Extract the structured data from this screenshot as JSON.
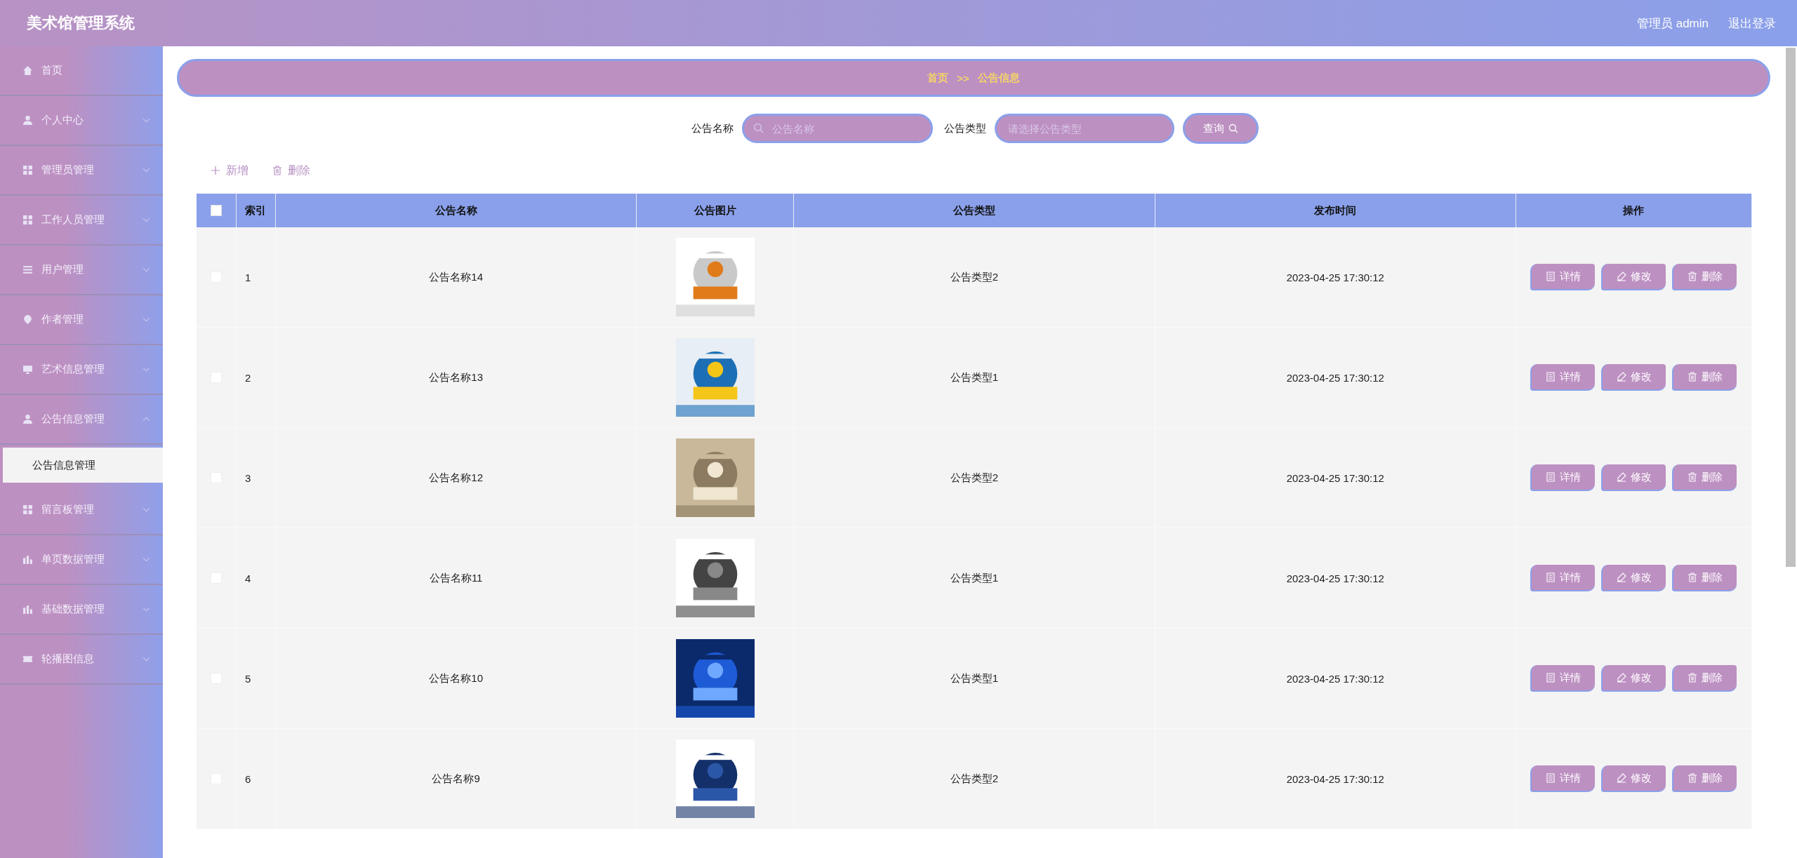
{
  "header": {
    "title": "美术馆管理系统",
    "user": "管理员 admin",
    "logout": "退出登录"
  },
  "sidebar": {
    "items": [
      {
        "label": "首页",
        "kind": "link"
      },
      {
        "label": "个人中心",
        "kind": "menu",
        "expanded": false
      },
      {
        "label": "管理员管理",
        "kind": "menu",
        "expanded": false
      },
      {
        "label": "工作人员管理",
        "kind": "menu",
        "expanded": false
      },
      {
        "label": "用户管理",
        "kind": "menu",
        "expanded": false
      },
      {
        "label": "作者管理",
        "kind": "menu",
        "expanded": false
      },
      {
        "label": "艺术信息管理",
        "kind": "menu",
        "expanded": false
      },
      {
        "label": "公告信息管理",
        "kind": "menu",
        "expanded": true,
        "children": [
          {
            "label": "公告信息管理",
            "selected": true
          }
        ]
      },
      {
        "label": "留言板管理",
        "kind": "menu",
        "expanded": false
      },
      {
        "label": "单页数据管理",
        "kind": "menu",
        "expanded": false
      },
      {
        "label": "基础数据管理",
        "kind": "menu",
        "expanded": false
      },
      {
        "label": "轮播图信息",
        "kind": "menu",
        "expanded": false
      }
    ]
  },
  "breadcrumb": [
    "首页",
    ">>",
    "公告信息"
  ],
  "search": {
    "fields": [
      {
        "label": "公告名称",
        "placeholder": "公告名称",
        "kind": "text"
      },
      {
        "label": "公告类型",
        "placeholder": "请选择公告类型",
        "kind": "select"
      }
    ],
    "button": "查询"
  },
  "actions": [
    {
      "label": "新增",
      "kind": "add"
    },
    {
      "label": "删除",
      "kind": "delete"
    }
  ],
  "table": {
    "select_all": {
      "checked": false
    },
    "columns": [
      "索引",
      "公告名称",
      "公告图片",
      "公告类型",
      "发布时间",
      "操作"
    ],
    "rows": [
      {
        "checked": false,
        "index": "1",
        "name": "公告名称14",
        "type": "公告类型2",
        "time": "2023-04-25 17:30:12",
        "actions": [
          {
            "label": "详情",
            "kind": "detail"
          },
          {
            "label": "修改",
            "kind": "edit"
          },
          {
            "label": "删除",
            "kind": "delete"
          }
        ]
      },
      {
        "checked": false,
        "index": "2",
        "name": "公告名称13",
        "type": "公告类型1",
        "time": "2023-04-25 17:30:12",
        "actions": [
          {
            "label": "详情",
            "kind": "detail"
          },
          {
            "label": "修改",
            "kind": "edit"
          },
          {
            "label": "删除",
            "kind": "delete"
          }
        ]
      },
      {
        "checked": false,
        "index": "3",
        "name": "公告名称12",
        "type": "公告类型2",
        "time": "2023-04-25 17:30:12",
        "actions": [
          {
            "label": "详情",
            "kind": "detail"
          },
          {
            "label": "修改",
            "kind": "edit"
          },
          {
            "label": "删除",
            "kind": "delete"
          }
        ]
      },
      {
        "checked": false,
        "index": "4",
        "name": "公告名称11",
        "type": "公告类型1",
        "time": "2023-04-25 17:30:12",
        "actions": [
          {
            "label": "详情",
            "kind": "detail"
          },
          {
            "label": "修改",
            "kind": "edit"
          },
          {
            "label": "删除",
            "kind": "delete"
          }
        ]
      },
      {
        "checked": false,
        "index": "5",
        "name": "公告名称10",
        "type": "公告类型1",
        "time": "2023-04-25 17:30:12",
        "actions": [
          {
            "label": "详情",
            "kind": "detail"
          },
          {
            "label": "修改",
            "kind": "edit"
          },
          {
            "label": "删除",
            "kind": "delete"
          }
        ]
      },
      {
        "checked": false,
        "index": "6",
        "name": "公告名称9",
        "type": "公告类型2",
        "time": "2023-04-25 17:30:12",
        "actions": [
          {
            "label": "详情",
            "kind": "detail"
          },
          {
            "label": "修改",
            "kind": "edit"
          },
          {
            "label": "删除",
            "kind": "delete"
          }
        ]
      }
    ]
  }
}
